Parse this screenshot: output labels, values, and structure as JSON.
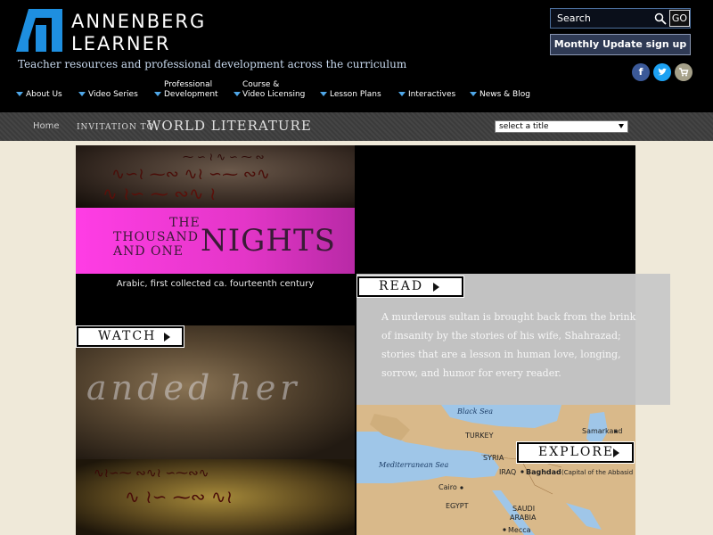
{
  "header": {
    "brand_line1": "ANNENBERG",
    "brand_line2": "LEARNER",
    "tagline": "Teacher resources and professional development across the curriculum",
    "search_placeholder": "Search",
    "go_label": "GO",
    "monthly_update_label": "Monthly Update sign up",
    "social": {
      "facebook": "f",
      "twitter": "t",
      "cart": "cart-icon"
    }
  },
  "nav": [
    {
      "label": "About Us"
    },
    {
      "label": "Video Series"
    },
    {
      "label_line1": "Professional",
      "label_line2": "Development"
    },
    {
      "label_line1": "Course &",
      "label_line2": "Video Licensing"
    },
    {
      "label": "Lesson Plans"
    },
    {
      "label": "Interactives"
    },
    {
      "label": "News & Blog"
    }
  ],
  "titlebar": {
    "home": "Home",
    "series_title_small": "INVITATION TO",
    "series_title_large": "WORLD LITERATURE",
    "select_value": "select a title"
  },
  "work": {
    "title_the": "THE",
    "title_thousand": "THOUSAND",
    "title_and_one": "AND ONE",
    "title_nights": "NIGHTS",
    "caption": "Arabic, first collected ca. fourteenth century",
    "description": "A murderous sultan is brought back from the brink of insanity by the stories of his wife, Shahrazad; stories that are a lesson in human love, longing, sorrow, and humor for every reader.",
    "ghost_text": "anded her"
  },
  "buttons": {
    "read": "READ",
    "watch": "WATCH",
    "explore": "EXPLORE"
  },
  "map": {
    "black_sea": "Black Sea",
    "mediterranean_sea": "Mediterranean Sea",
    "turkey": "TURKEY",
    "syria": "SYRIA",
    "iraq": "IRAQ",
    "baghdad": "Baghdad",
    "baghdad_note": "(Capital of the Abbasid",
    "samarkand": "Samarkand",
    "cairo": "Cairo",
    "egypt": "EGYPT",
    "saudi": "SAUDI",
    "arabia": "ARABIA",
    "mecca": "Mecca"
  },
  "colors": {
    "header_bg": "#000000",
    "banner_magenta": "#ff3de5",
    "nav_arrow": "#4fa7e8",
    "page_bg": "#efe9d9"
  }
}
